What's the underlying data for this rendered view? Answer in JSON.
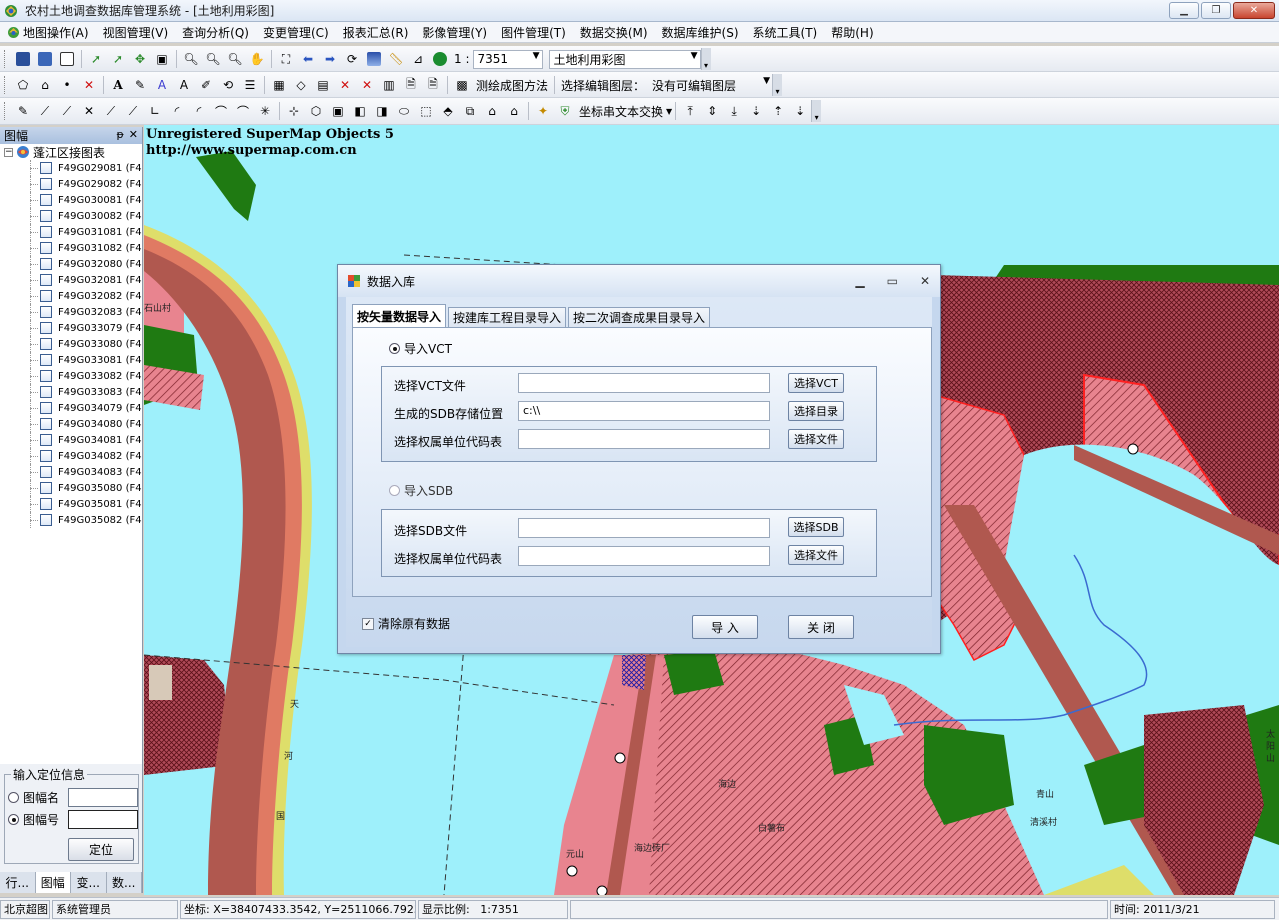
{
  "window": {
    "title": "农村土地调查数据库管理系统 - [土地利用彩图]",
    "buttons": [
      "▁",
      "❐",
      "✕"
    ]
  },
  "menu": [
    {
      "label": "地图操作(A)",
      "icon": "map-icon"
    },
    {
      "label": "视图管理(V)"
    },
    {
      "label": "查询分析(Q)"
    },
    {
      "label": "变更管理(C)"
    },
    {
      "label": "报表汇总(R)"
    },
    {
      "label": "影像管理(Y)"
    },
    {
      "label": "图件管理(T)"
    },
    {
      "label": "数据交换(M)"
    },
    {
      "label": "数据库维护(S)"
    },
    {
      "label": "系统工具(T)"
    },
    {
      "label": "帮助(H)"
    }
  ],
  "mdi_controls": [
    "▁",
    "🗗",
    "✕"
  ],
  "toolbar1": {
    "scale_prefix": "1 :",
    "scale_value": "7351",
    "layer_value": "土地利用彩图"
  },
  "toolbar2": {
    "measure_method": "测绘成图方法",
    "edit_layer_label": "选择编辑图层：",
    "edit_layer_value": "没有可编辑图层"
  },
  "toolbar3": {
    "coord_transform": "坐标串文本交换"
  },
  "left_panel": {
    "title": "图幅",
    "pin": "ᵽ",
    "close": "✕",
    "root": "蓬江区接图表",
    "sheets": [
      "F49G029081 (F4",
      "F49G029082 (F4",
      "F49G030081 (F4",
      "F49G030082 (F4",
      "F49G031081 (F4",
      "F49G031082 (F4",
      "F49G032080 (F4",
      "F49G032081 (F4",
      "F49G032082 (F4",
      "F49G032083 (F4",
      "F49G033079 (F4",
      "F49G033080 (F4",
      "F49G033081 (F4",
      "F49G033082 (F4",
      "F49G033083 (F4",
      "F49G034079 (F4",
      "F49G034080 (F4",
      "F49G034081 (F4",
      "F49G034082 (F4",
      "F49G034083 (F4",
      "F49G035080 (F4",
      "F49G035081 (F4",
      "F49G035082 (F4"
    ]
  },
  "locator": {
    "legend": "输入定位信息",
    "opt_name": "图幅名",
    "opt_number": "图幅号",
    "button": "定位",
    "selected": "图幅号"
  },
  "left_tabs": [
    "行...",
    "图幅",
    "变...",
    "数..."
  ],
  "map": {
    "watermark1": "Unregistered SuperMap Objects 5",
    "watermark2": "http://www.supermap.com.cn",
    "labels": {
      "shan_cun": "石山村",
      "tian": "天",
      "he": "河",
      "guo": "国",
      "haibian": "海边",
      "baihe": "白薯布",
      "haibian_factory": "海边砖厂",
      "yuanshan": "元山",
      "qingshan": "青山",
      "qingxi_cun": "清溪村",
      "taiyang_shan": "太阳山"
    },
    "colors": {
      "water": "#9ef0fb",
      "road": "#b0584f",
      "road_edge": "#e07a63",
      "road_yellow": "#dede6a",
      "rural": "#e8848f",
      "forest": "#1f7a12",
      "hatched_red": "#ff3a3a"
    }
  },
  "dialog": {
    "title": "数据入库",
    "tabs": [
      "按矢量数据导入",
      "按建库工程目录导入",
      "按二次调查成果目录导入"
    ],
    "active_tab": "按矢量数据导入",
    "vct": {
      "radio_label": "导入VCT",
      "selected": true,
      "fields": [
        {
          "label": "选择VCT文件",
          "value": "",
          "button": "选择VCT"
        },
        {
          "label": "生成的SDB存储位置",
          "value": "c:\\\\",
          "button": "选择目录"
        },
        {
          "label": "选择权属单位代码表",
          "value": "",
          "button": "选择文件"
        }
      ]
    },
    "sdb": {
      "radio_label": "导入SDB",
      "selected": false,
      "fields": [
        {
          "label": "选择SDB文件",
          "value": "",
          "button": "选择SDB"
        },
        {
          "label": "选择权属单位代码表",
          "value": "",
          "button": "选择文件"
        }
      ]
    },
    "clear_checkbox": "清除原有数据",
    "clear_checked": true,
    "import_button": "导 入",
    "close_button": "关 闭"
  },
  "status": {
    "org": "北京超图",
    "user": "系统管理员",
    "coord": "坐标: X=38407433.3542, Y=2511066.7923",
    "scale_label": "显示比例:",
    "scale": "1:7351",
    "time": "时间: 2011/3/21"
  }
}
